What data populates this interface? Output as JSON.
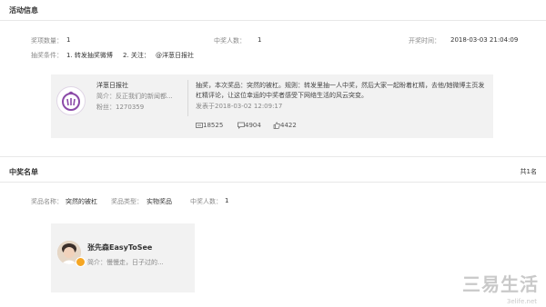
{
  "activity": {
    "title": "活动信息",
    "prize_count_label": "奖项数量：",
    "prize_count": "1",
    "winner_count_label": "中奖人数：",
    "winner_count": "1",
    "draw_time_label": "开奖时间：",
    "draw_time": "2018-03-03 21:04:09",
    "conditions_label": "抽奖条件：",
    "condition_1": "1. 转发抽奖微博",
    "condition_2": "2. 关注：",
    "condition_2_account": "@洋葱日报社"
  },
  "post": {
    "account_name": "洋葱日报社",
    "intro": "简介：反正我们的新闻都...",
    "fans": "粉丝：1270359",
    "text": "抽奖，本次奖品：突然的被杠。规则：转发里抽一人中奖，然后大家一起盼着杠精，去他/她微博主页发杠精评论，让这位幸运的中奖者感受下网络生活的风云突变。",
    "posted": "发表于2018-03-02 12:09:17",
    "reposts": "18525",
    "comments": "4904",
    "likes": "4422"
  },
  "winners": {
    "title": "中奖名单",
    "total": "共1名",
    "prize_name_label": "奖品名称：",
    "prize_name": "突然的被杠",
    "prize_type_label": "奖品类型：",
    "prize_type": "实物奖品",
    "winner_count_label": "中奖人数：",
    "winner_count": "1",
    "user_name": "张先森EasyToSee",
    "user_intro": "简介：慢慢走，日子过的..."
  },
  "watermark": {
    "text": "三易生活",
    "url": "3elife.net"
  },
  "colors": {
    "card_bg": "#f2f2f2",
    "avatar_purple": "#8b4aa8",
    "divider": "#e8e8e8"
  }
}
